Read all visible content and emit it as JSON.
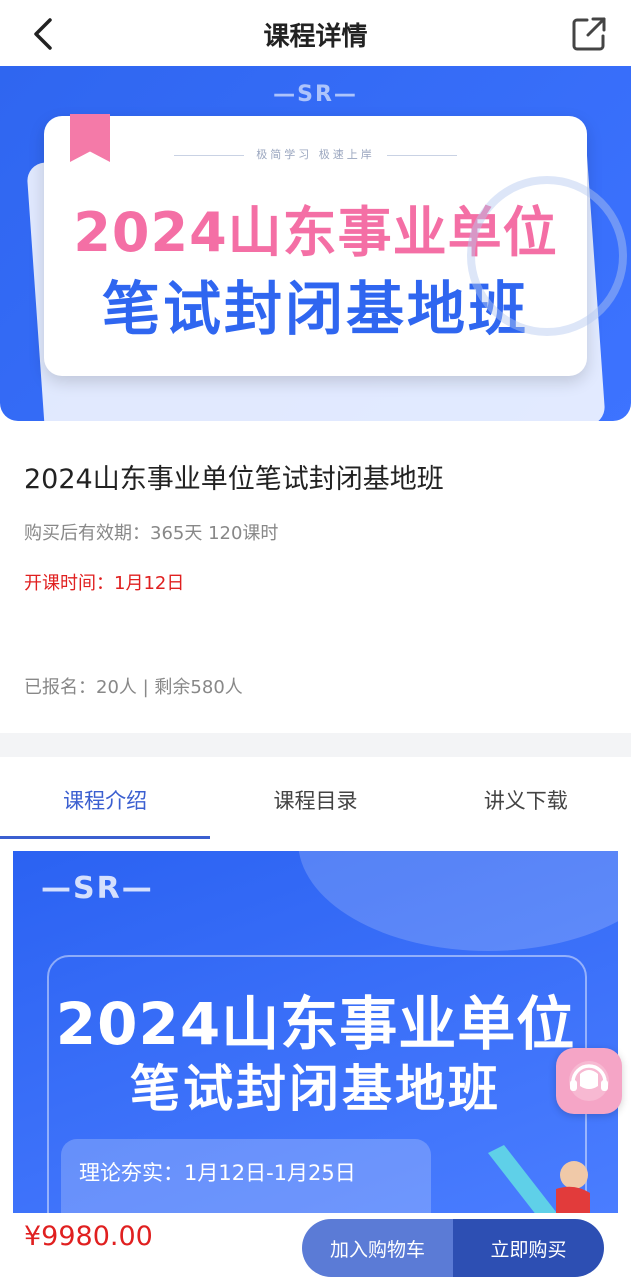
{
  "header": {
    "title": "课程详情",
    "back_icon": "back-arrow-icon",
    "share_icon": "share-icon"
  },
  "banner": {
    "logo": "—SR—",
    "slogan": "极简学习  极速上岸",
    "line1": "2024山东事业单位",
    "line2": "笔试封闭基地班"
  },
  "course": {
    "name": "2024山东事业单位笔试封闭基地班",
    "validity": "购买后有效期：365天 120课时",
    "start_time": "开课时间：1月12日",
    "enrolled": "已报名：20人 | 剩余580人"
  },
  "tabs": [
    {
      "label": "课程介绍",
      "active": true
    },
    {
      "label": "课程目录",
      "active": false
    },
    {
      "label": "讲义下载",
      "active": false
    }
  ],
  "poster": {
    "logo": "—SR—",
    "line1": "2024山东事业单位",
    "line2": "笔试封闭基地班",
    "schedule": "理论夯实：1月12日-1月25日"
  },
  "bottom_bar": {
    "price": "¥9980.00",
    "cart_label": "加入购物车",
    "buy_label": "立即购买"
  },
  "colors": {
    "accent": "#3b5fd0",
    "price_red": "#e02020",
    "banner_blue": "#2f66f0",
    "banner_pink": "#f46fa5"
  }
}
